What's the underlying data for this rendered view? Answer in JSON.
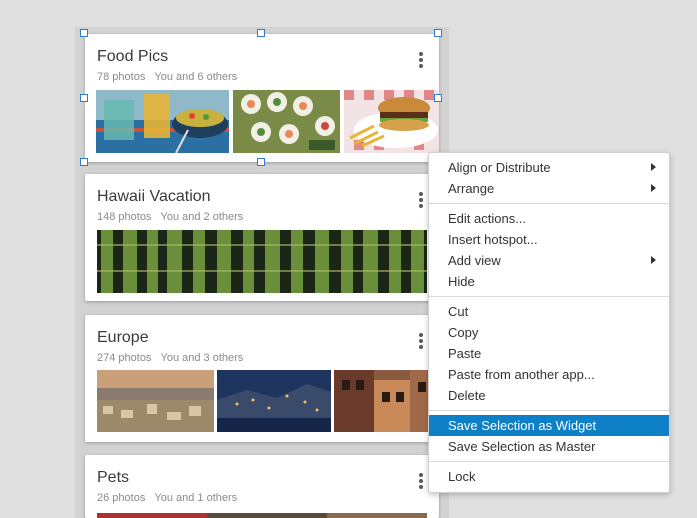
{
  "cards": [
    {
      "title": "Food Pics",
      "count": "78 photos",
      "sharing": "You and 6 others"
    },
    {
      "title": "Hawaii Vacation",
      "count": "148 photos",
      "sharing": "You and 2 others"
    },
    {
      "title": "Europe",
      "count": "274 photos",
      "sharing": "You and 3 others"
    },
    {
      "title": "Pets",
      "count": "26 photos",
      "sharing": "You and 1 others"
    }
  ],
  "context_menu": {
    "items": [
      {
        "label": "Align or Distribute",
        "submenu": true
      },
      {
        "label": "Arrange",
        "submenu": true
      },
      {
        "label": "Edit actions..."
      },
      {
        "label": "Insert hotspot..."
      },
      {
        "label": "Add view",
        "submenu": true
      },
      {
        "label": "Hide"
      },
      {
        "label": "Cut"
      },
      {
        "label": "Copy"
      },
      {
        "label": "Paste"
      },
      {
        "label": "Paste from another app..."
      },
      {
        "label": "Delete"
      },
      {
        "label": "Save Selection as Widget",
        "highlighted": true
      },
      {
        "label": "Save Selection as Master"
      },
      {
        "label": "Lock"
      }
    ]
  },
  "colors": {
    "menu_highlight": "#0e80c8",
    "selection_handle": "#2f7bd0"
  }
}
